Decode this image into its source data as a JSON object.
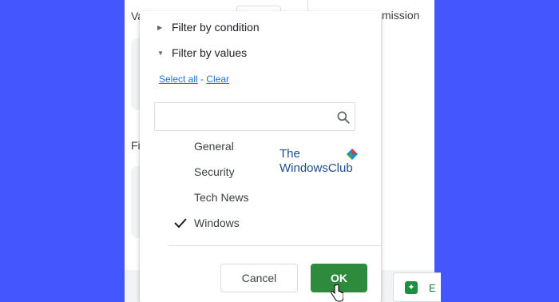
{
  "background": {
    "accent": "#4457ff",
    "left_letters": [
      "Va",
      "Fi"
    ],
    "right_fragment": "mission",
    "explore_label": "E"
  },
  "dropdown": {
    "filter_by_condition": "Filter by condition",
    "filter_by_values": "Filter by values",
    "select_all": "Select all",
    "separator": " - ",
    "clear": "Clear",
    "search": {
      "value": "",
      "placeholder": ""
    },
    "values": [
      {
        "label": "General",
        "checked": false
      },
      {
        "label": "Security",
        "checked": false
      },
      {
        "label": "Tech News",
        "checked": false
      },
      {
        "label": "Windows",
        "checked": true
      }
    ],
    "cancel_label": "Cancel",
    "ok_label": "OK",
    "ok_color": "#2e8b3e",
    "link_color": "#1a73e8"
  },
  "watermark": {
    "line1": "The",
    "line2": "WindowsClub"
  }
}
